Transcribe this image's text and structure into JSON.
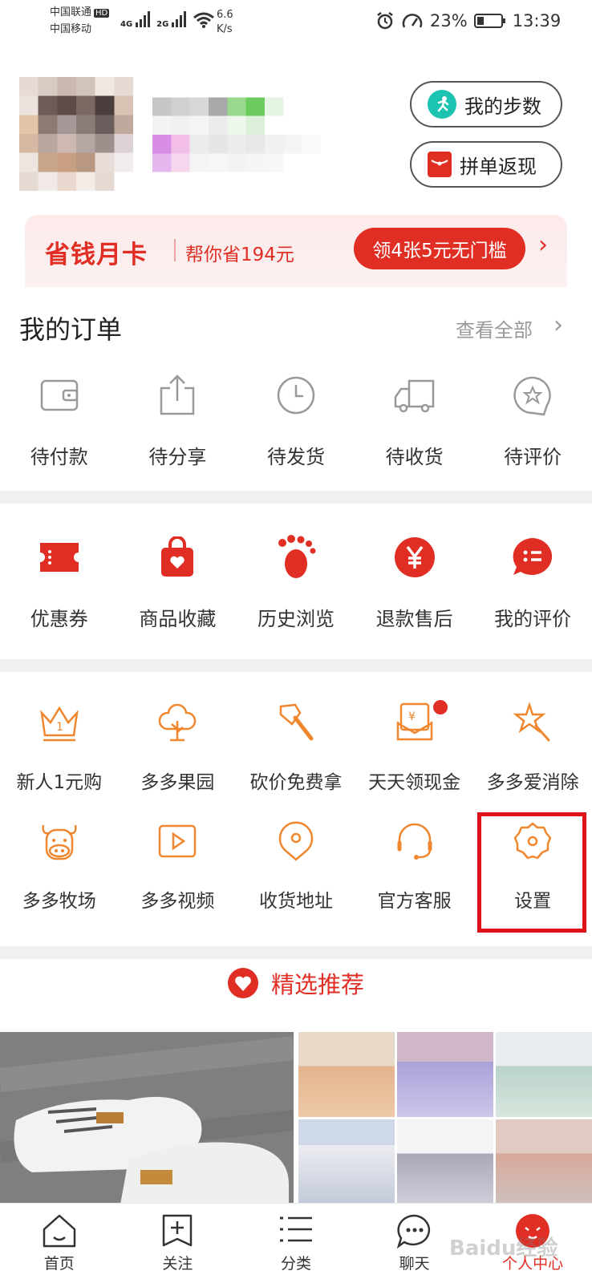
{
  "status_bar": {
    "carrier1": "中国联通",
    "carrier2": "中国移动",
    "hd": "HD",
    "net1": "4G",
    "net2": "2G",
    "speed_value": "6.6",
    "speed_unit": "K/s",
    "battery": "23%",
    "time": "13:39"
  },
  "header": {
    "steps_label": "我的步数",
    "cashback_label": "拼单返现"
  },
  "banner": {
    "title": "省钱月卡",
    "subtitle": "帮你省194元",
    "button": "领4张5元无门槛",
    "arrow": "›"
  },
  "orders": {
    "title": "我的订单",
    "view_all": "查看全部",
    "arrow": "›",
    "items": [
      {
        "label": "待付款",
        "icon": "wallet-icon"
      },
      {
        "label": "待分享",
        "icon": "share-icon"
      },
      {
        "label": "待发货",
        "icon": "clock-icon"
      },
      {
        "label": "待收货",
        "icon": "truck-icon"
      },
      {
        "label": "待评价",
        "icon": "review-star-icon"
      }
    ]
  },
  "services": {
    "items": [
      {
        "label": "优惠券",
        "icon": "coupon-icon"
      },
      {
        "label": "商品收藏",
        "icon": "favorites-bag-icon"
      },
      {
        "label": "历史浏览",
        "icon": "footprint-icon"
      },
      {
        "label": "退款售后",
        "icon": "refund-yen-icon"
      },
      {
        "label": "我的评价",
        "icon": "my-review-icon"
      }
    ]
  },
  "features": {
    "row1": [
      {
        "label": "新人1元购",
        "icon": "crown-icon"
      },
      {
        "label": "多多果园",
        "icon": "tree-icon"
      },
      {
        "label": "砍价免费拿",
        "icon": "axe-icon"
      },
      {
        "label": "天天领现金",
        "icon": "cash-envelope-icon"
      },
      {
        "label": "多多爱消除",
        "icon": "star-wand-icon"
      }
    ],
    "row2": [
      {
        "label": "多多牧场",
        "icon": "cow-icon"
      },
      {
        "label": "多多视频",
        "icon": "video-play-icon"
      },
      {
        "label": "收货地址",
        "icon": "location-pin-icon"
      },
      {
        "label": "官方客服",
        "icon": "headset-icon"
      },
      {
        "label": "设置",
        "icon": "settings-gear-icon"
      }
    ]
  },
  "recommend": {
    "title": "精选推荐"
  },
  "tabbar": {
    "items": [
      {
        "label": "首页",
        "icon": "home-icon"
      },
      {
        "label": "关注",
        "icon": "follow-plus-icon"
      },
      {
        "label": "分类",
        "icon": "category-list-icon"
      },
      {
        "label": "聊天",
        "icon": "chat-bubble-icon"
      },
      {
        "label": "个人中心",
        "icon": "profile-face-icon"
      }
    ],
    "active_index": 4
  },
  "watermark": "Baidu经验",
  "colors": {
    "brand_red": "#e02e24",
    "accent_orange": "#f0862e",
    "highlight_box": "#e0101a"
  }
}
